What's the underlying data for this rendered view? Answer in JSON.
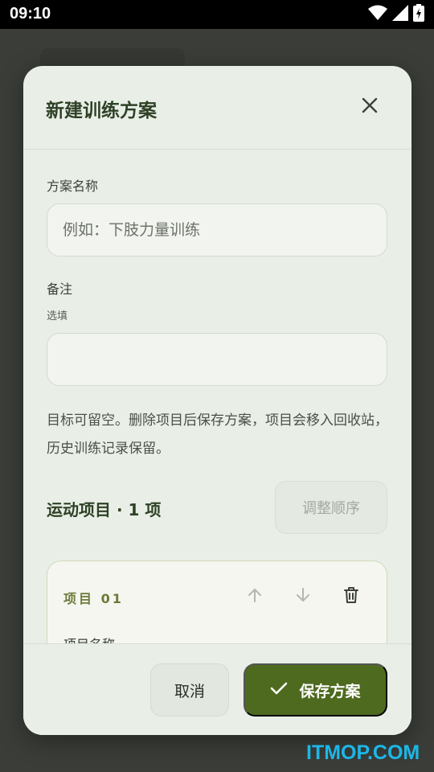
{
  "status_bar": {
    "time": "09:10"
  },
  "dialog": {
    "title": "新建训练方案",
    "name_field": {
      "label": "方案名称",
      "placeholder": "例如：下肢力量训练",
      "value": ""
    },
    "notes_field": {
      "label": "备注",
      "hint": "选填",
      "value": ""
    },
    "info": "目标可留空。删除项目后保存方案，项目会移入回收站，历史训练记录保留。",
    "section": {
      "title": "运动项目 · 1 项",
      "reorder_label": "调整顺序"
    },
    "items": [
      {
        "index_label": "项目 01",
        "name_label": "项目名称"
      }
    ],
    "footer": {
      "cancel_label": "取消",
      "save_label": "保存方案"
    }
  },
  "watermark": "ITMOP.COM",
  "colors": {
    "accent": "#4e6a1f",
    "title": "#2e4126",
    "surface": "#e9efe7",
    "card": "#f4f6ef"
  }
}
